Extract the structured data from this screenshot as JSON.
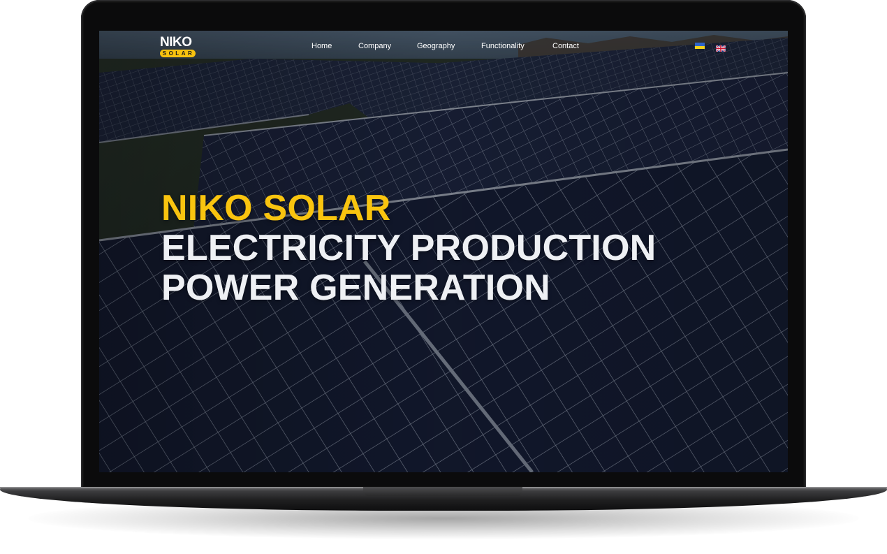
{
  "nav": {
    "logo_top": "NIKO",
    "logo_badge": "SOLAR",
    "items": [
      {
        "label": "Home"
      },
      {
        "label": "Company"
      },
      {
        "label": "Geography"
      },
      {
        "label": "Functionality"
      },
      {
        "label": "Contact"
      }
    ],
    "languages": [
      {
        "icon": "ukraine-flag-icon"
      },
      {
        "icon": "uk-flag-icon"
      }
    ]
  },
  "hero": {
    "line1": "NIKO SOLAR",
    "line2": "ELECTRICITY PRODUCTION",
    "line3": "POWER GENERATION"
  },
  "colors": {
    "accent": "#f9c40f",
    "headline_text": "#eef0f4",
    "panel_blue": "#1b2238"
  }
}
